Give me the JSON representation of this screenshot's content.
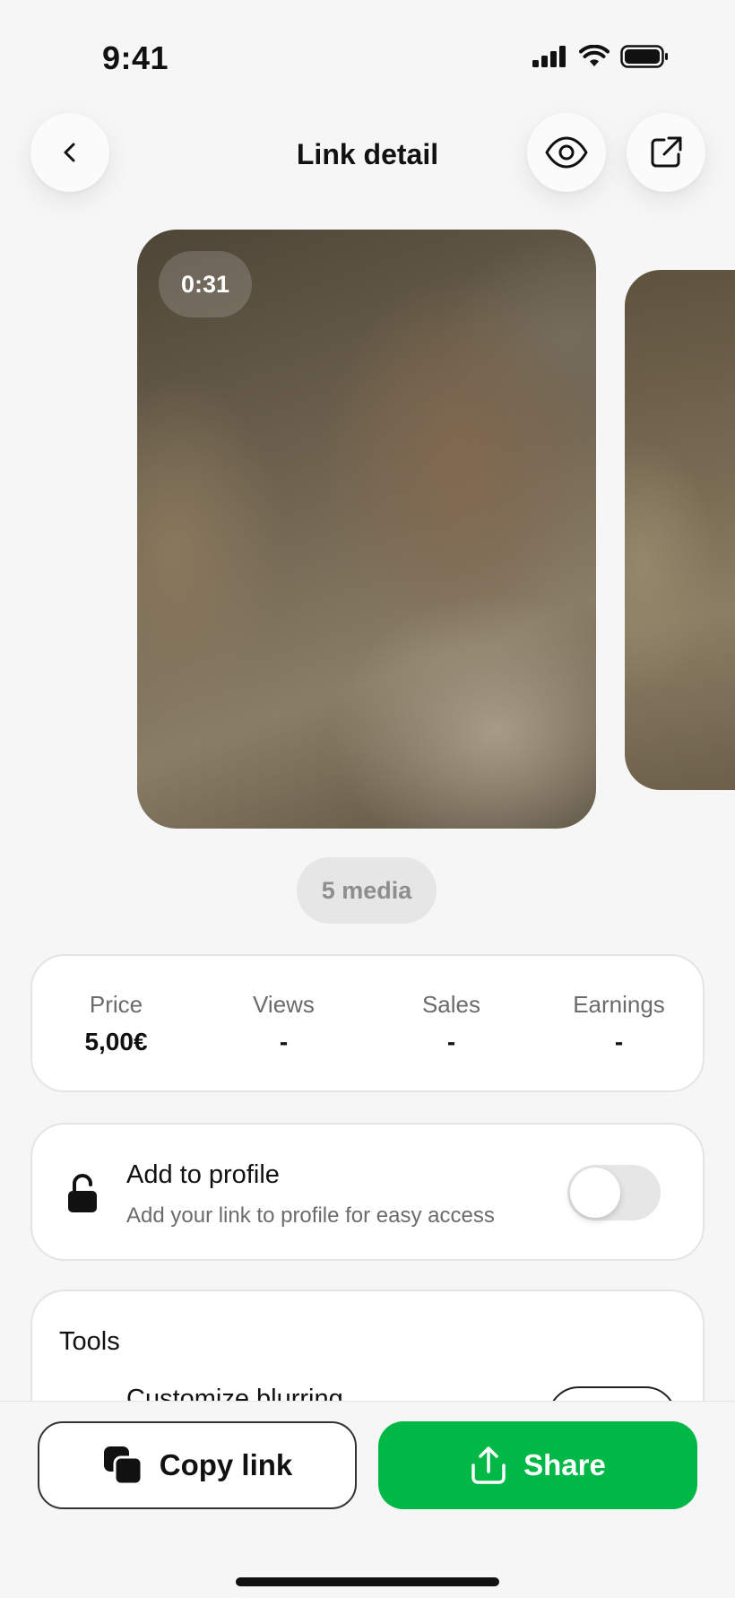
{
  "status_bar": {
    "time": "9:41"
  },
  "header": {
    "title": "Link detail"
  },
  "media": {
    "duration": "0:31",
    "count_label": "5 media"
  },
  "stats": [
    {
      "label": "Price",
      "value": "5,00€"
    },
    {
      "label": "Views",
      "value": "-"
    },
    {
      "label": "Sales",
      "value": "-"
    },
    {
      "label": "Earnings",
      "value": "-"
    }
  ],
  "profile": {
    "title": "Add to profile",
    "subtitle": "Add your link to profile for easy access",
    "enabled": false
  },
  "tools": {
    "title": "Tools",
    "items": [
      {
        "label": "Customize blurring"
      }
    ]
  },
  "actions": {
    "copy_label": "Copy link",
    "share_label": "Share"
  },
  "colors": {
    "accent_green": "#00b846",
    "background": "#f6f6f6",
    "card_border": "#e4e4e4"
  },
  "icons": {
    "back": "chevron-left-icon",
    "preview": "eye-icon",
    "open_external": "external-link-icon",
    "lock": "unlock-icon",
    "copy": "copy-icon",
    "share": "share-icon"
  }
}
